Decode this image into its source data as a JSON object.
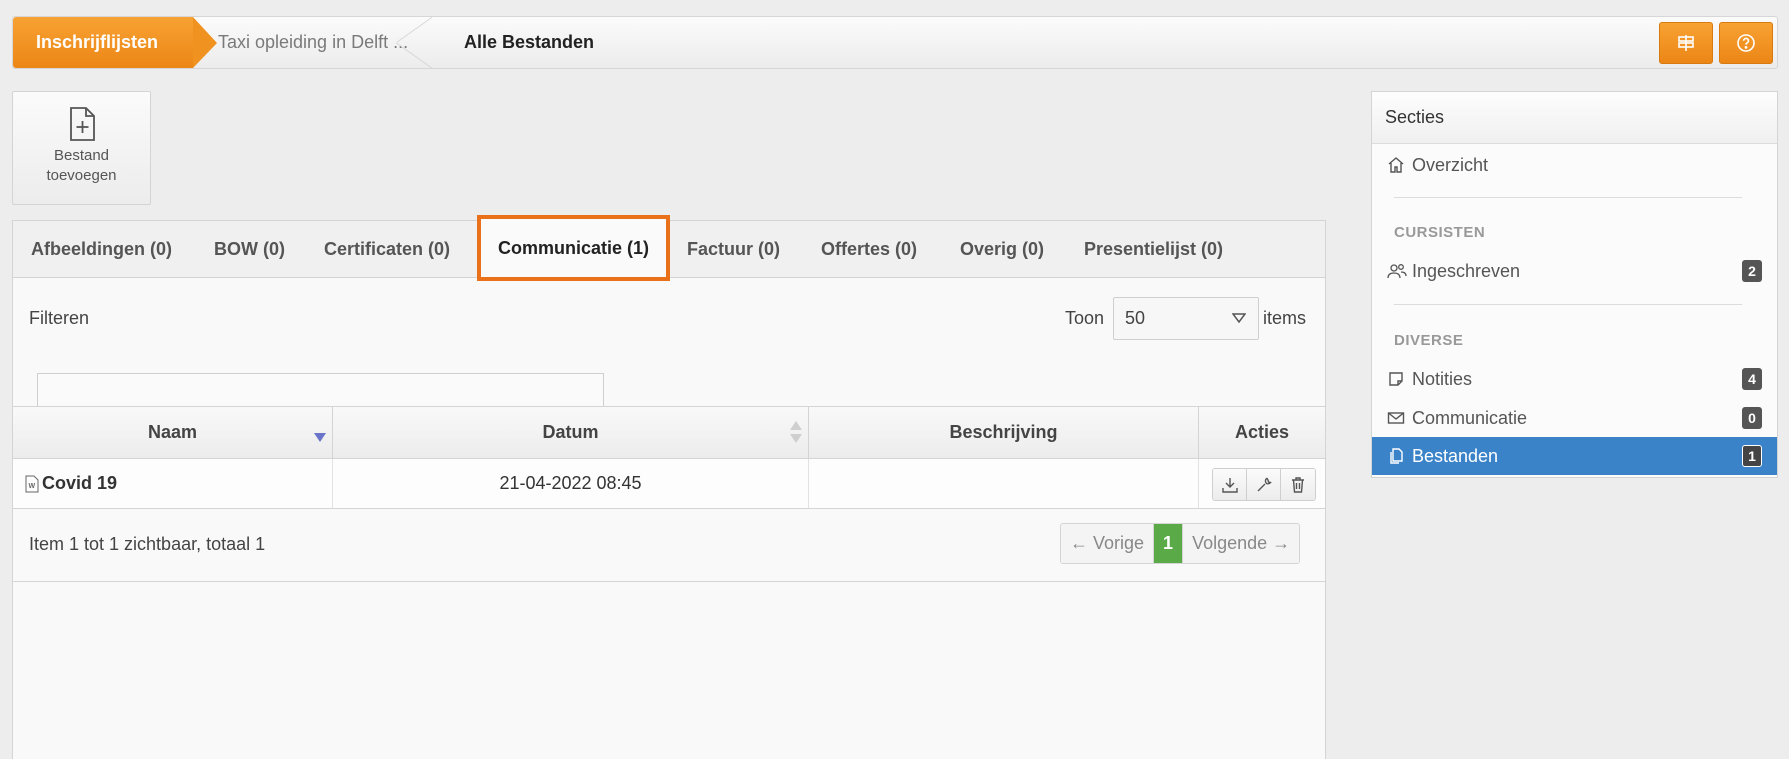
{
  "breadcrumb": {
    "home": "Inschrijflijsten",
    "middle": "Taxi opleiding in Delft ...",
    "current": "Alle Bestanden"
  },
  "toolbar": {
    "signpost_icon": "signpost-icon",
    "help_icon": "help-circle-icon"
  },
  "add_file": {
    "label_line1": "Bestand",
    "label_line2": "toevoegen"
  },
  "tabs": [
    {
      "label": "Afbeeldingen (0)"
    },
    {
      "label": "BOW (0)"
    },
    {
      "label": "Certificaten (0)"
    },
    {
      "label": "Communicatie (1)",
      "active": true
    },
    {
      "label": "Factuur (0)"
    },
    {
      "label": "Offertes (0)"
    },
    {
      "label": "Overig (0)"
    },
    {
      "label": "Presentielijst (0)"
    }
  ],
  "filter": {
    "label": "Filteren",
    "show_label": "Toon",
    "page_size": "50",
    "items_label": "items",
    "search_value": ""
  },
  "table": {
    "columns": [
      "Naam",
      "Datum",
      "Beschrijving",
      "Acties"
    ],
    "rows": [
      {
        "name": "Covid 19",
        "date": "21-04-2022 08:45",
        "description": ""
      }
    ]
  },
  "footer": {
    "visible_text": "Item 1 tot 1 zichtbaar, totaal 1",
    "prev": "← Vorige",
    "page": "1",
    "next": "Volgende →"
  },
  "sidebar": {
    "title": "Secties",
    "overview": "Overzicht",
    "group1": "CURSISTEN",
    "ingeschreven": "Ingeschreven",
    "ingeschreven_count": "2",
    "group2": "DIVERSE",
    "notities": "Notities",
    "notities_count": "4",
    "communicatie": "Communicatie",
    "communicatie_count": "0",
    "bestanden": "Bestanden",
    "bestanden_count": "1"
  },
  "colors": {
    "accent_orange": "#ec8616",
    "active_blue": "#3a83c8",
    "pager_green": "#5aaa47",
    "highlight_border": "#e8711a"
  }
}
